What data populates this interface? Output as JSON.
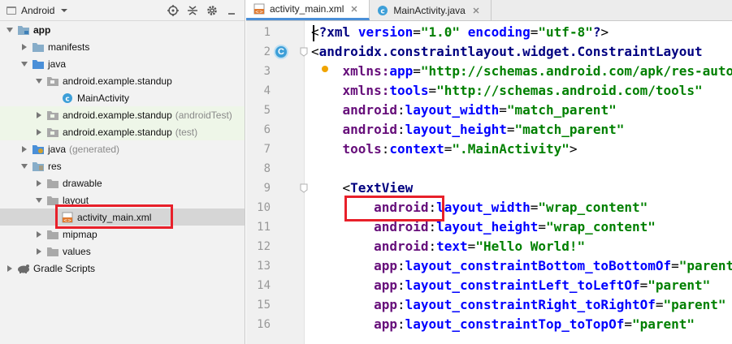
{
  "project_panel": {
    "view_label": "Android",
    "tree": [
      {
        "label": "app",
        "suffix": "",
        "icon": "module-folder-icon"
      },
      {
        "label": "manifests",
        "suffix": "",
        "icon": "folder-icon"
      },
      {
        "label": "java",
        "suffix": "",
        "icon": "folder-icon"
      },
      {
        "label": "android.example.standup",
        "suffix": "",
        "icon": "package-icon"
      },
      {
        "label": "MainActivity",
        "suffix": "",
        "icon": "class-icon"
      },
      {
        "label": "android.example.standup",
        "suffix": "(androidTest)",
        "icon": "package-icon"
      },
      {
        "label": "android.example.standup",
        "suffix": "(test)",
        "icon": "package-icon"
      },
      {
        "label": "java",
        "suffix": "(generated)",
        "icon": "generated-folder-icon"
      },
      {
        "label": "res",
        "suffix": "",
        "icon": "res-folder-icon"
      },
      {
        "label": "drawable",
        "suffix": "",
        "icon": "folder-icon"
      },
      {
        "label": "layout",
        "suffix": "",
        "icon": "folder-icon"
      },
      {
        "label": "activity_main.xml",
        "suffix": "",
        "icon": "xml-file-icon"
      },
      {
        "label": "mipmap",
        "suffix": "",
        "icon": "folder-icon"
      },
      {
        "label": "values",
        "suffix": "",
        "icon": "folder-icon"
      },
      {
        "label": "Gradle Scripts",
        "suffix": "",
        "icon": "gradle-icon"
      }
    ]
  },
  "editor": {
    "tabs": [
      {
        "label": "activity_main.xml",
        "icon": "xml-file-icon",
        "active": true
      },
      {
        "label": "MainActivity.java",
        "icon": "class-icon",
        "active": false
      }
    ],
    "line_numbers": [
      "1",
      "2",
      "3",
      "4",
      "5",
      "6",
      "7",
      "8",
      "9",
      "10",
      "11",
      "12",
      "13",
      "14",
      "15",
      "16"
    ],
    "gutter_badge": "C",
    "code": [
      {
        "indent": "",
        "segs": [
          [
            "plain",
            "<"
          ],
          [
            "tag",
            "?xml "
          ],
          [
            "attr",
            "version"
          ],
          [
            "plain",
            "="
          ],
          [
            "val",
            "\"1.0\""
          ],
          [
            "plain",
            " "
          ],
          [
            "attr",
            "encoding"
          ],
          [
            "plain",
            "="
          ],
          [
            "val",
            "\"utf-8\""
          ],
          [
            "tag",
            "?"
          ],
          [
            "plain",
            ">"
          ]
        ]
      },
      {
        "indent": "",
        "segs": [
          [
            "plain",
            "<"
          ],
          [
            "tag",
            "androidx.constraintlayout.widget.ConstraintLayout"
          ]
        ]
      },
      {
        "indent": "    ",
        "segs": [
          [
            "ns",
            "xmlns:"
          ],
          [
            "attr",
            "app"
          ],
          [
            "plain",
            "="
          ],
          [
            "val",
            "\"http://schemas.android.com/apk/res-auto\""
          ]
        ]
      },
      {
        "indent": "    ",
        "segs": [
          [
            "ns",
            "xmlns:"
          ],
          [
            "attr",
            "tools"
          ],
          [
            "plain",
            "="
          ],
          [
            "val",
            "\"http://schemas.android.com/tools\""
          ]
        ]
      },
      {
        "indent": "    ",
        "segs": [
          [
            "ns",
            "android"
          ],
          [
            "plain",
            ":"
          ],
          [
            "attr",
            "layout_width"
          ],
          [
            "plain",
            "="
          ],
          [
            "val",
            "\"match_parent\""
          ]
        ]
      },
      {
        "indent": "    ",
        "segs": [
          [
            "ns",
            "android"
          ],
          [
            "plain",
            ":"
          ],
          [
            "attr",
            "layout_height"
          ],
          [
            "plain",
            "="
          ],
          [
            "val",
            "\"match_parent\""
          ]
        ]
      },
      {
        "indent": "    ",
        "segs": [
          [
            "ns",
            "tools"
          ],
          [
            "plain",
            ":"
          ],
          [
            "attr",
            "context"
          ],
          [
            "plain",
            "="
          ],
          [
            "val",
            "\".MainActivity\""
          ],
          [
            "plain",
            ">"
          ]
        ]
      },
      {
        "indent": "",
        "segs": []
      },
      {
        "indent": "    ",
        "segs": [
          [
            "plain",
            "<"
          ],
          [
            "tag",
            "TextView"
          ]
        ]
      },
      {
        "indent": "        ",
        "segs": [
          [
            "ns",
            "android"
          ],
          [
            "plain",
            ":"
          ],
          [
            "attr",
            "layout_width"
          ],
          [
            "plain",
            "="
          ],
          [
            "val",
            "\"wrap_content\""
          ]
        ]
      },
      {
        "indent": "        ",
        "segs": [
          [
            "ns",
            "android"
          ],
          [
            "plain",
            ":"
          ],
          [
            "attr",
            "layout_height"
          ],
          [
            "plain",
            "="
          ],
          [
            "val",
            "\"wrap_content\""
          ]
        ]
      },
      {
        "indent": "        ",
        "segs": [
          [
            "ns",
            "android"
          ],
          [
            "plain",
            ":"
          ],
          [
            "attr",
            "text"
          ],
          [
            "plain",
            "="
          ],
          [
            "val",
            "\"Hello World!\""
          ]
        ]
      },
      {
        "indent": "        ",
        "segs": [
          [
            "ns",
            "app"
          ],
          [
            "plain",
            ":"
          ],
          [
            "attr",
            "layout_constraintBottom_toBottomOf"
          ],
          [
            "plain",
            "="
          ],
          [
            "val",
            "\"parent\""
          ]
        ]
      },
      {
        "indent": "        ",
        "segs": [
          [
            "ns",
            "app"
          ],
          [
            "plain",
            ":"
          ],
          [
            "attr",
            "layout_constraintLeft_toLeftOf"
          ],
          [
            "plain",
            "="
          ],
          [
            "val",
            "\"parent\""
          ]
        ]
      },
      {
        "indent": "        ",
        "segs": [
          [
            "ns",
            "app"
          ],
          [
            "plain",
            ":"
          ],
          [
            "attr",
            "layout_constraintRight_toRightOf"
          ],
          [
            "plain",
            "="
          ],
          [
            "val",
            "\"parent\""
          ]
        ]
      },
      {
        "indent": "        ",
        "segs": [
          [
            "ns",
            "app"
          ],
          [
            "plain",
            ":"
          ],
          [
            "attr",
            "layout_constraintTop_toTopOf"
          ],
          [
            "plain",
            "="
          ],
          [
            "val",
            "\"parent\""
          ]
        ]
      }
    ]
  },
  "colors": {
    "highlight": "#e8202a",
    "tag": "#000080",
    "namespace": "#660e7a",
    "attribute": "#0000ff",
    "value": "#008000"
  }
}
